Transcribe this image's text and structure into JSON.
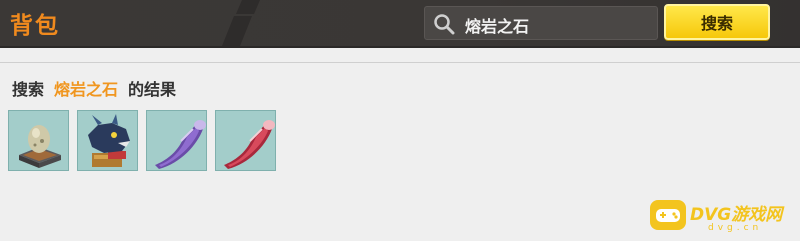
{
  "header": {
    "title": "背包",
    "search": {
      "value": "熔岩之石"
    },
    "search_button_label": "搜索"
  },
  "results": {
    "prefix": "搜索",
    "keyword": "熔岩之石",
    "suffix": "的结果",
    "items": [
      {
        "icon": "egg-on-pedestal-icon"
      },
      {
        "icon": "dragon-head-mount-icon"
      },
      {
        "icon": "purple-horn-icon"
      },
      {
        "icon": "red-horn-icon"
      }
    ]
  },
  "watermark": {
    "text": "DVG游戏网",
    "sub": "dvg.cn"
  },
  "colors": {
    "topbar": "#3b3836",
    "title": "#f08a1e",
    "keyword": "#f0961f",
    "button": "#f6c80a",
    "slot": "#a3cdca"
  }
}
